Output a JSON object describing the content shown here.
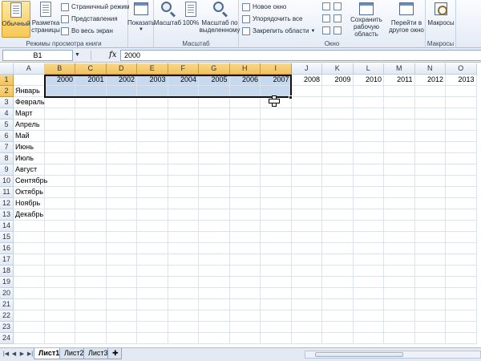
{
  "ribbon": {
    "groups": {
      "workbook_views": "Режимы просмотра книги",
      "zoom": "Масштаб",
      "window": "Окно",
      "macros": "Макросы"
    },
    "buttons": {
      "normal": "Обычный",
      "page_layout": "Разметка страницы",
      "page_break": "Страничный режим",
      "custom_views": "Представления",
      "full_screen": "Во весь экран",
      "show": "Показать",
      "zoom": "Масштаб",
      "zoom100": "100%",
      "zoom_selection": "Масштаб по выделенному",
      "new_window": "Новое окно",
      "arrange_all": "Упорядочить все",
      "freeze_panes": "Закрепить области",
      "save_workspace": "Сохранить рабочую область",
      "switch_windows": "Перейти в другое окно",
      "macros": "Макросы"
    }
  },
  "formula_bar": {
    "name_box": "B1",
    "fx": "fx",
    "value": "2000"
  },
  "grid": {
    "columns": [
      "A",
      "B",
      "C",
      "D",
      "E",
      "F",
      "G",
      "H",
      "I",
      "J",
      "K",
      "L",
      "M",
      "N",
      "O"
    ],
    "rows": [
      "1",
      "2",
      "3",
      "4",
      "5",
      "6",
      "7",
      "8",
      "9",
      "10",
      "11",
      "12",
      "13",
      "14",
      "15",
      "16",
      "17",
      "18",
      "19",
      "20",
      "21",
      "22",
      "23",
      "24"
    ],
    "row1_years": [
      "2000",
      "2001",
      "2002",
      "2003",
      "2004",
      "2005",
      "2006",
      "2007",
      "2008",
      "2009",
      "2010",
      "2011",
      "2012",
      "2013"
    ],
    "months": [
      "Январь",
      "Февраль",
      "Март",
      "Апрель",
      "Май",
      "Июнь",
      "Июль",
      "Август",
      "Сентябрь",
      "Октябрь",
      "Ноябрь",
      "Декабрь"
    ]
  },
  "sheets": {
    "tabs": [
      "Лист1",
      "Лист2",
      "Лист3"
    ],
    "active": "Лист1"
  },
  "colors": {
    "selection": "#c7d9ef",
    "header_selected": "#f1c15c",
    "ribbon_active": "#f7c853"
  }
}
